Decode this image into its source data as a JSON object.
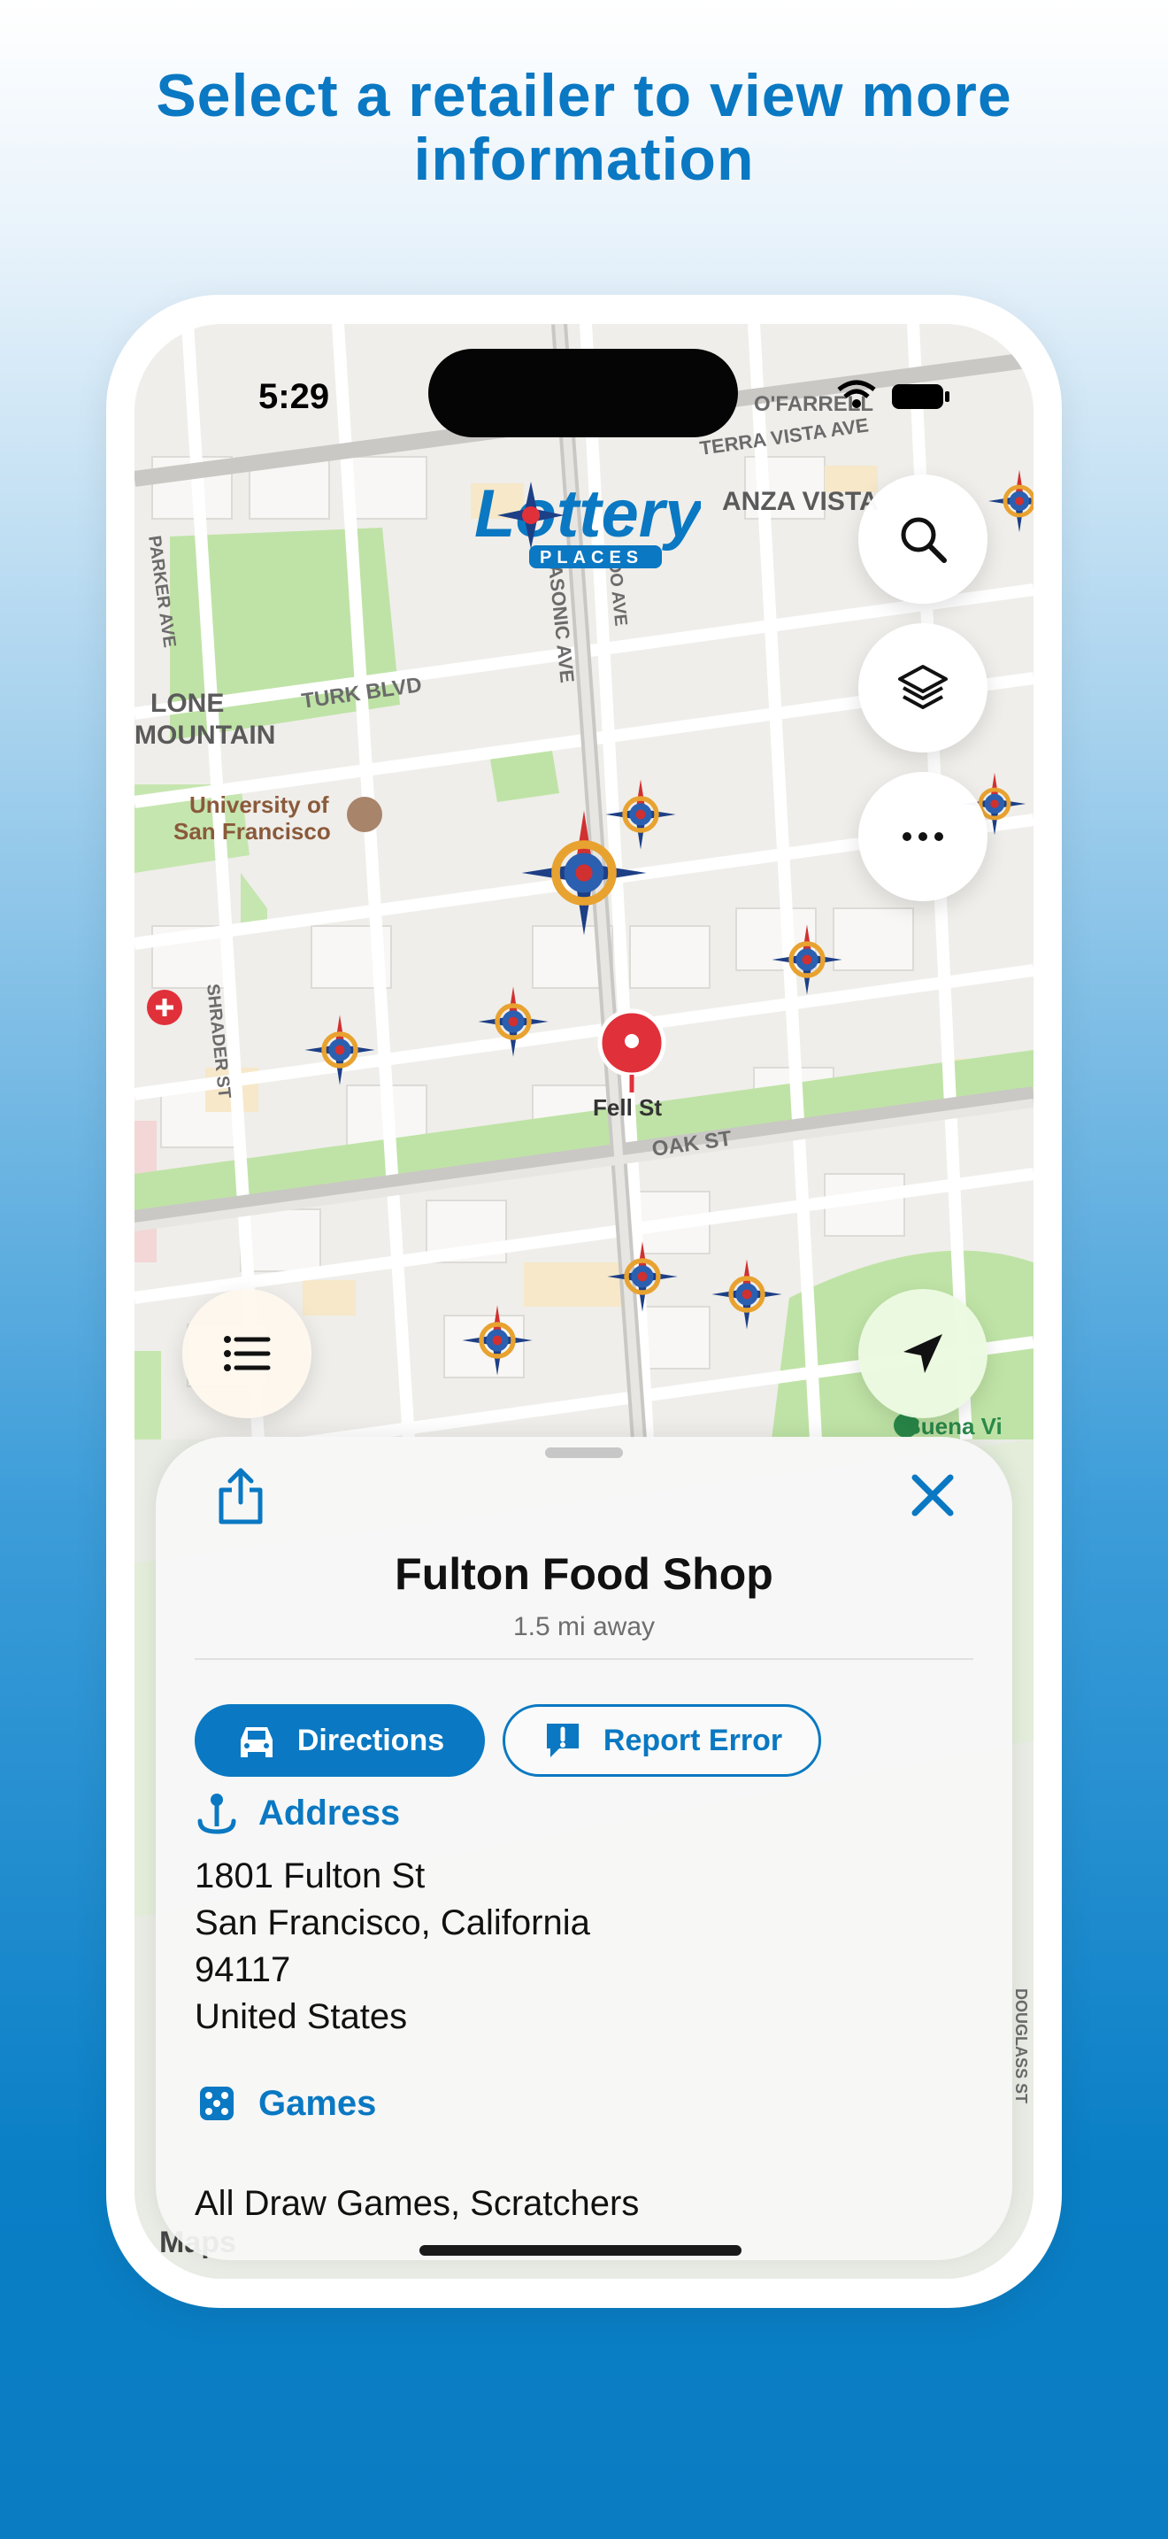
{
  "headline": "Select a retailer to view more information",
  "status_bar": {
    "time": "5:29"
  },
  "map": {
    "labels": {
      "o_farrell": "O'FARRELL",
      "terra_vista": "TERRA VISTA AVE",
      "anza_vista": "ANZA VISTA",
      "parker": "PARKER AVE",
      "lone_mountain_1": "LONE",
      "lone_mountain_2": "MOUNTAIN",
      "turk": "TURK BLVD",
      "masonic": "MASONIC AVE",
      "lido": "LIDO AVE",
      "usf_1": "University of",
      "usf_2": "San Francisco",
      "shrader": "SHRADER ST",
      "fell": "Fell St",
      "oak": "OAK ST",
      "buena_vista": "Buena Vi",
      "douglass": "DOUGLASS ST",
      "attribution": "Maps"
    },
    "logo_main": "Lottery",
    "logo_sub": "PLACES"
  },
  "place": {
    "name": "Fulton Food Shop",
    "distance": "1.5 mi away"
  },
  "actions": {
    "directions": "Directions",
    "report_error": "Report Error"
  },
  "address": {
    "heading": "Address",
    "lines": [
      "1801 Fulton St",
      "San Francisco, California",
      "94117",
      "United States"
    ]
  },
  "games": {
    "heading": "Games",
    "value": "All Draw Games, Scratchers"
  },
  "colors": {
    "brand_blue": "#0a78c2",
    "pin_red": "#e0303a",
    "park_green": "#bfe3a6"
  }
}
